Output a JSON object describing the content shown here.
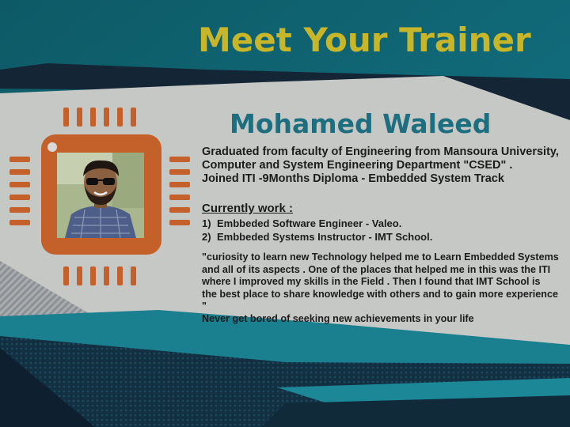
{
  "page": {
    "title": "Meet Your Trainer"
  },
  "trainer": {
    "name": "Mohamed Waleed",
    "education": [
      "Graduated from faculty of Engineering from Mansoura University,",
      "Computer and System Engineering Department \"CSED\"  .",
      "Joined ITI -9Months Diploma - Embedded System Track"
    ],
    "current_work_heading": "Currently work :",
    "current_work": [
      {
        "num": "1)",
        "text": "Embbeded Software Engineer  -  Valeo."
      },
      {
        "num": "2)",
        "text": "Embbeded Systems Instructor  -   IMT School."
      }
    ],
    "quote_lines": [
      "\"curiosity to learn new Technology helped me to Learn Embedded Systems",
      "and all of its aspects . One of the places that helped me in this was the ITI",
      "where I improved my skills in the Field . Then I found that IMT School is",
      "the best place to share knowledge with others and to gain more experience \"",
      "Never get bored of seeking new achievements in your life"
    ]
  },
  "colors": {
    "title": "#c8b62a",
    "name": "#1d6f80",
    "teal_background": "#0f5f6b",
    "card": "#c5c7c5",
    "chip_orange": "#c4612a"
  }
}
